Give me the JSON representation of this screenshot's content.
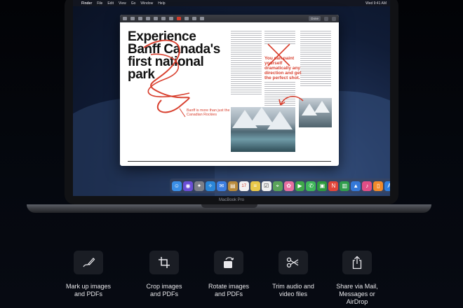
{
  "menubar": {
    "apple": "",
    "app": "Finder",
    "items": [
      "File",
      "Edit",
      "View",
      "Go",
      "Window",
      "Help"
    ],
    "clock": "Wed 9:41 AM"
  },
  "preview": {
    "done_label": "Done",
    "headline": "Experience Banff Canada's first national park",
    "annotation": "Banff is more than just the Canadian Rockies",
    "pull_quote": "You can paint yourself dramatically any direction and get the perfect shot."
  },
  "dock": {
    "icons": [
      {
        "name": "finder-icon",
        "glyph": "☺",
        "color": "#3a8ee6"
      },
      {
        "name": "siri-icon",
        "glyph": "◉",
        "color": "#6a4ed6"
      },
      {
        "name": "launchpad-icon",
        "glyph": "✦",
        "color": "#7c7f88"
      },
      {
        "name": "safari-icon",
        "glyph": "✧",
        "color": "#2a86d8"
      },
      {
        "name": "mail-icon",
        "glyph": "✉",
        "color": "#3c7ee0"
      },
      {
        "name": "notes-icon",
        "glyph": "▤",
        "color": "#b88a3a"
      },
      {
        "name": "calendar-icon",
        "glyph": "17",
        "color": "#f2f2f2"
      },
      {
        "name": "notes-app-icon",
        "glyph": "≡",
        "color": "#e8c84a"
      },
      {
        "name": "reminders-icon",
        "glyph": "☑",
        "color": "#f0f0f0"
      },
      {
        "name": "maps-icon",
        "glyph": "⌖",
        "color": "#5aa35a"
      },
      {
        "name": "photos-icon",
        "glyph": "✿",
        "color": "#e76fa0"
      },
      {
        "name": "facetime-icon",
        "glyph": "▶",
        "color": "#3fa84a"
      },
      {
        "name": "messages-icon",
        "glyph": "✆",
        "color": "#3fb65a"
      },
      {
        "name": "facetime-video-icon",
        "glyph": "▣",
        "color": "#2e9a3e"
      },
      {
        "name": "news-icon",
        "glyph": "N",
        "color": "#e2453a"
      },
      {
        "name": "numbers-icon",
        "glyph": "▥",
        "color": "#2f9d4c"
      },
      {
        "name": "keynote-icon",
        "glyph": "▲",
        "color": "#3478d8"
      },
      {
        "name": "itunes-icon",
        "glyph": "♪",
        "color": "#e04e86"
      },
      {
        "name": "books-icon",
        "glyph": "▯",
        "color": "#f08a2a"
      },
      {
        "name": "app-store-icon",
        "glyph": "A",
        "color": "#2e7fe0"
      },
      {
        "name": "system-preferences-icon",
        "glyph": "⚙",
        "color": "#7e8088"
      },
      {
        "name": "downloads-icon",
        "glyph": "⤓",
        "color": "#4b8fd6"
      },
      {
        "name": "trash-icon",
        "glyph": "▥",
        "color": "#6f737c"
      }
    ]
  },
  "laptop": {
    "model": "MacBook Pro"
  },
  "features": [
    {
      "icon": "markup-icon",
      "label": "Mark up images\nand PDFs"
    },
    {
      "icon": "crop-icon",
      "label": "Crop images\nand PDFs"
    },
    {
      "icon": "rotate-icon",
      "label": "Rotate images\nand PDFs"
    },
    {
      "icon": "trim-icon",
      "label": "Trim audio and\nvideo files"
    },
    {
      "icon": "share-icon",
      "label": "Share via Mail,\nMessages or\nAirDrop"
    }
  ]
}
